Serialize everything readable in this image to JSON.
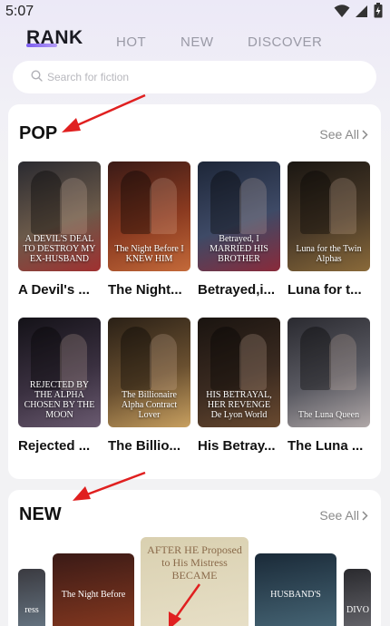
{
  "status": {
    "time": "5:07"
  },
  "tabs": [
    {
      "label": "RANK"
    },
    {
      "label": "HOT"
    },
    {
      "label": "NEW"
    },
    {
      "label": "DISCOVER"
    }
  ],
  "search": {
    "placeholder": "Search for fiction"
  },
  "pop": {
    "title": "POP",
    "see_all": "See All",
    "books": [
      {
        "title": "A Devil's ...",
        "cover_text": "A DEVIL'S DEAL TO DESTROY MY EX-HUSBAND",
        "colors": [
          "#2a2a30",
          "#6b5a4a",
          "#a03030"
        ]
      },
      {
        "title": "The Night...",
        "cover_text": "The Night Before I KNEW HIM",
        "colors": [
          "#3a1a16",
          "#8a3a20",
          "#c46a3a"
        ]
      },
      {
        "title": "Betrayed,i...",
        "cover_text": "Betrayed, I MARRIED HIS BROTHER",
        "colors": [
          "#1d2638",
          "#3e4a66",
          "#8a2a3a"
        ]
      },
      {
        "title": "Luna for t...",
        "cover_text": "Luna for the Twin Alphas",
        "colors": [
          "#1a1612",
          "#4a3a28",
          "#8a6a3a"
        ]
      },
      {
        "title": "Rejected ...",
        "cover_text": "REJECTED BY THE ALPHA CHOSEN BY THE MOON",
        "colors": [
          "#141218",
          "#3a3040",
          "#6a5a70"
        ]
      },
      {
        "title": "The Billio...",
        "cover_text": "The Billionaire Alpha Contract Lover",
        "colors": [
          "#2a2016",
          "#6a5030",
          "#c8a060"
        ]
      },
      {
        "title": "His Betray...",
        "cover_text": "HIS BETRAYAL, HER REVENGE De Lyon World",
        "colors": [
          "#1a1410",
          "#3a2a20",
          "#6a4a30"
        ]
      },
      {
        "title": "The Luna ...",
        "cover_text": "The Luna Queen",
        "colors": [
          "#2a2a30",
          "#5a5a62",
          "#b0a8a8"
        ]
      }
    ]
  },
  "new": {
    "title": "NEW",
    "see_all": "See All",
    "items": [
      {
        "cover_text": "ress",
        "colors": [
          "#3a3a40",
          "#6a7a88"
        ]
      },
      {
        "cover_text": "The Night Before",
        "colors": [
          "#3a1a16",
          "#8a3a20"
        ]
      },
      {
        "cover_text": "AFTER HE Proposed to His Mistress BECAME",
        "colors": [
          "#d9d0b0",
          "#e8e0c8"
        ]
      },
      {
        "cover_text": "HUSBAND'S",
        "colors": [
          "#1a2a38",
          "#4a6a7a"
        ]
      },
      {
        "cover_text": "DIVO",
        "colors": [
          "#2a2a2e",
          "#6a6a70"
        ]
      }
    ]
  },
  "colors": {
    "accent": "#7b5cf0",
    "arrow": "#e02020"
  }
}
